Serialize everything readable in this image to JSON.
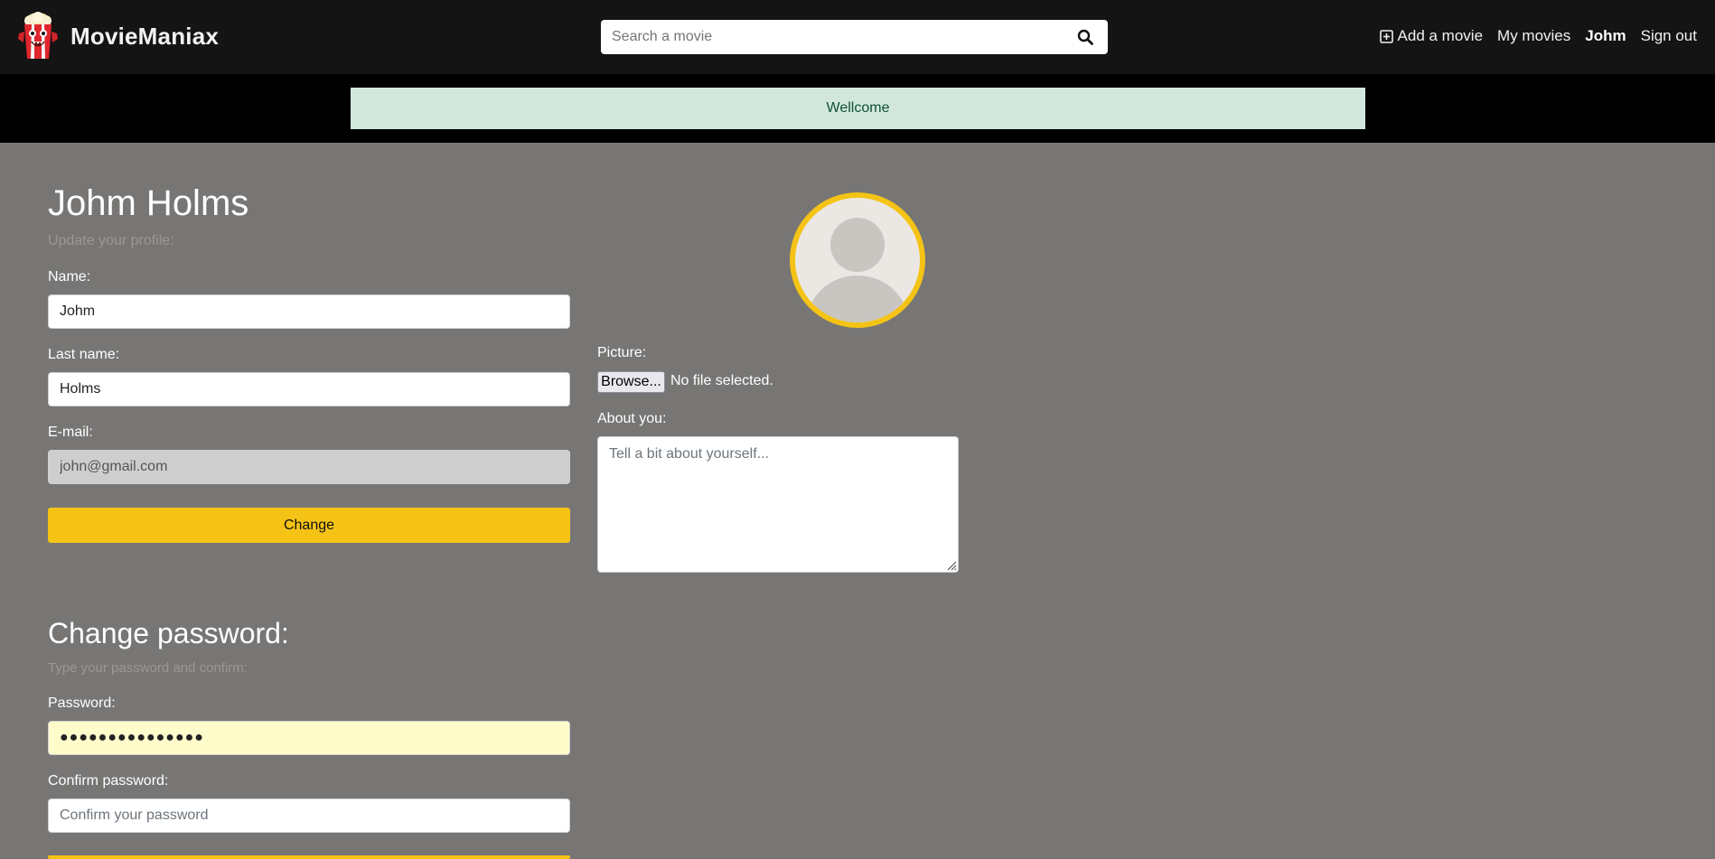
{
  "brand": {
    "name": "MovieManiax"
  },
  "search": {
    "placeholder": "Search a movie"
  },
  "nav": {
    "add_movie": "Add a movie",
    "my_movies": "My movies",
    "user": "Johm",
    "sign_out": "Sign out"
  },
  "alert": {
    "message": "Wellcome"
  },
  "profile": {
    "title": "Johm Holms",
    "subtitle": "Update your profile:",
    "name_label": "Name:",
    "name_value": "Johm",
    "last_name_label": "Last name:",
    "last_name_value": "Holms",
    "email_label": "E-mail:",
    "email_value": "john@gmail.com",
    "submit_label": "Change"
  },
  "picture": {
    "label": "Picture:",
    "browse_label": "Browse...",
    "file_status": "No file selected."
  },
  "about": {
    "label": "About you:",
    "placeholder": "Tell a bit about yourself..."
  },
  "password": {
    "title": "Change password:",
    "subtitle": "Type your password and confirm:",
    "password_label": "Password:",
    "password_value": "●●●●●●●●●●●●●●●",
    "confirm_label": "Confirm password:",
    "confirm_placeholder": "Confirm your password"
  },
  "colors": {
    "accent": "#f4c316",
    "topbar": "#141414",
    "page_bg": "#787674",
    "alert_bg": "#d1e7dd",
    "alert_text": "#0f5132"
  },
  "icons": {
    "logo": "popcorn-mascot-icon",
    "search": "search-icon",
    "add": "plus-square-icon",
    "avatar": "default-user-icon",
    "resize": "resize-grip-icon"
  }
}
